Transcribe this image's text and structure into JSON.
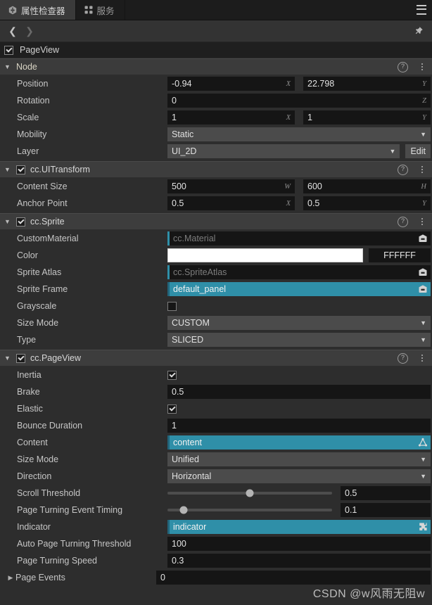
{
  "tabs": [
    {
      "label": "属性检查器",
      "icon": "inspector-hex-icon",
      "active": true
    },
    {
      "label": "服务",
      "icon": "services-grid-icon",
      "active": false
    }
  ],
  "toolbar": {
    "menu_icon": "hamburger-menu-icon",
    "back_icon": "chevron-left-icon",
    "forward_icon": "chevron-right-icon",
    "pin_icon": "pin-icon"
  },
  "node_name": {
    "enabled": true,
    "value": "PageView"
  },
  "sections": [
    {
      "key": "node",
      "title": "Node",
      "has_checkbox": false,
      "checked": false,
      "help_icon": "help-circle-icon",
      "menu_icon": "kebab-menu-icon",
      "rows": [
        {
          "label": "Position",
          "type": "vec2",
          "x": "-0.94",
          "y": "22.798",
          "x_axis": "X",
          "y_axis": "Y"
        },
        {
          "label": "Rotation",
          "type": "scalar",
          "value": "0",
          "axis": "Z"
        },
        {
          "label": "Scale",
          "type": "vec2",
          "x": "1",
          "y": "1",
          "x_axis": "X",
          "y_axis": "Y"
        },
        {
          "label": "Mobility",
          "type": "select",
          "value": "Static"
        },
        {
          "label": "Layer",
          "type": "select-edit",
          "value": "UI_2D",
          "button": "Edit"
        }
      ]
    },
    {
      "key": "uitransform",
      "title": "cc.UITransform",
      "has_checkbox": true,
      "checked": true,
      "help_icon": "help-circle-icon",
      "menu_icon": "kebab-menu-icon",
      "rows": [
        {
          "label": "Content Size",
          "type": "vec2",
          "x": "500",
          "y": "600",
          "x_axis": "W",
          "y_axis": "H"
        },
        {
          "label": "Anchor Point",
          "type": "vec2",
          "x": "0.5",
          "y": "0.5",
          "x_axis": "X",
          "y_axis": "Y"
        }
      ]
    },
    {
      "key": "sprite",
      "title": "cc.Sprite",
      "has_checkbox": true,
      "checked": true,
      "help_icon": "help-circle-icon",
      "menu_icon": "kebab-menu-icon",
      "rows": [
        {
          "label": "CustomMaterial",
          "type": "asset",
          "value": "cc.Material",
          "filled": false,
          "icon": "asset-box-icon"
        },
        {
          "label": "Color",
          "type": "color",
          "swatch": "#FFFFFF",
          "hex": "FFFFFF"
        },
        {
          "label": "Sprite Atlas",
          "type": "asset",
          "value": "cc.SpriteAtlas",
          "filled": false,
          "icon": "asset-box-icon"
        },
        {
          "label": "Sprite Frame",
          "type": "asset",
          "value": "default_panel",
          "filled": true,
          "icon": "asset-box-icon"
        },
        {
          "label": "Grayscale",
          "type": "checkbox",
          "checked": false
        },
        {
          "label": "Size Mode",
          "type": "select",
          "value": "CUSTOM"
        },
        {
          "label": "Type",
          "type": "select",
          "value": "SLICED"
        }
      ]
    },
    {
      "key": "pageview",
      "title": "cc.PageView",
      "has_checkbox": true,
      "checked": true,
      "help_icon": "help-circle-icon",
      "menu_icon": "kebab-menu-icon",
      "rows": [
        {
          "label": "Inertia",
          "type": "checkbox",
          "checked": true
        },
        {
          "label": "Brake",
          "type": "scalar",
          "value": "0.5",
          "axis": ""
        },
        {
          "label": "Elastic",
          "type": "checkbox",
          "checked": true
        },
        {
          "label": "Bounce Duration",
          "type": "scalar",
          "value": "1",
          "axis": ""
        },
        {
          "label": "Content",
          "type": "asset",
          "value": "content",
          "filled": true,
          "icon": "node-icon"
        },
        {
          "label": "Size Mode",
          "type": "select",
          "value": "Unified"
        },
        {
          "label": "Direction",
          "type": "select",
          "value": "Horizontal"
        },
        {
          "label": "Scroll Threshold",
          "type": "slider",
          "value": "0.5",
          "percent": 50
        },
        {
          "label": "Page Turning Event Timing",
          "type": "slider",
          "value": "0.1",
          "percent": 10
        },
        {
          "label": "Indicator",
          "type": "asset",
          "value": "indicator",
          "filled": true,
          "icon": "component-puzzle-icon"
        },
        {
          "label": "Auto Page Turning Threshold",
          "type": "scalar",
          "value": "100",
          "axis": ""
        },
        {
          "label": "Page Turning Speed",
          "type": "scalar",
          "value": "0.3",
          "axis": ""
        },
        {
          "label": "Page Events",
          "type": "foldout",
          "value": "0"
        }
      ]
    }
  ],
  "watermark": "CSDN @w风雨无阻w",
  "colors": {
    "accent_teal": "#2f8fa8",
    "panel_bg": "#2d2d2d",
    "header_bg": "#3d3d3d",
    "input_bg": "#151515",
    "select_bg": "#4b4b4b"
  }
}
